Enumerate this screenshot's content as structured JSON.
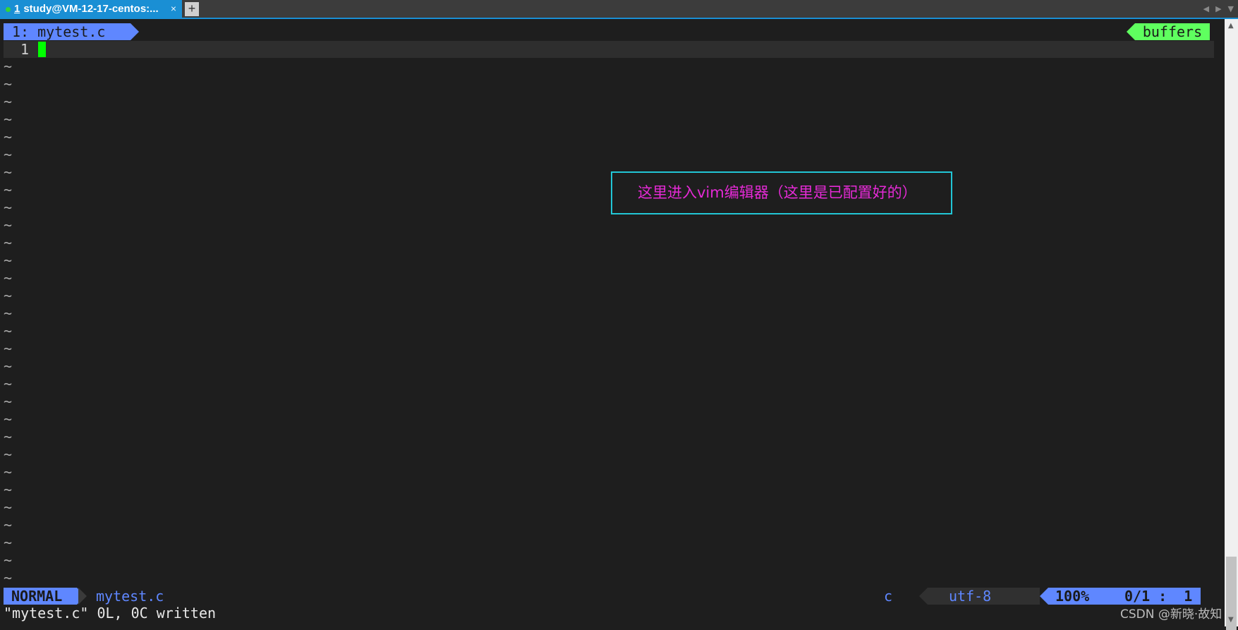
{
  "window": {
    "tab_number": "1",
    "tab_title": "study@VM-12-17-centos:...",
    "tab_close": "×",
    "new_tab": "+",
    "nav_prev": "◀",
    "nav_next": "▶",
    "nav_menu": "▼"
  },
  "vim": {
    "buffer_tab": "1: mytest.c",
    "buffers_label": "buffers",
    "line_number": "1",
    "tilde": "~",
    "status": {
      "mode": "NORMAL",
      "filename": "mytest.c",
      "filetype": "c",
      "encoding": "utf-8",
      "percent": "100%",
      "line_col": "0/1 :  1"
    },
    "message": "\"mytest.c\" 0L, 0C written"
  },
  "annotation": {
    "text": "这里进入vim编辑器（这里是已配置好的）",
    "color": "#e52ad6",
    "border_color": "#22c6d6"
  },
  "watermark": "CSDN @新晓·故知",
  "colors": {
    "accent_blue": "#5f87ff",
    "accent_green": "#5fff5f",
    "cursor": "#00ff00",
    "tab_blue": "#1a8fd4"
  }
}
